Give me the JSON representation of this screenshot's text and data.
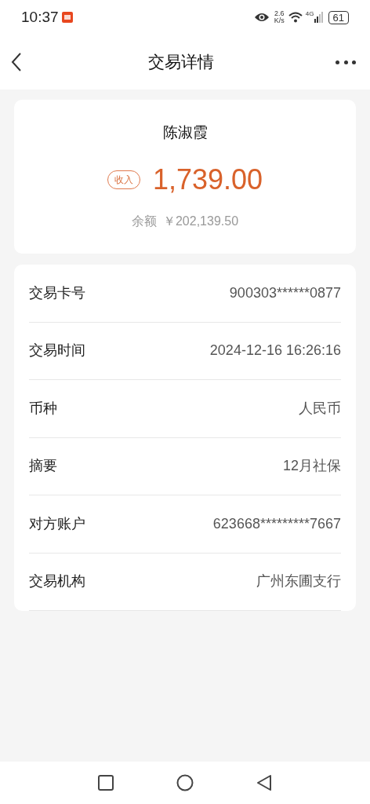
{
  "status_bar": {
    "time": "10:37",
    "net_speed": "2.6",
    "net_unit": "K/s",
    "network": "4G",
    "battery": "61"
  },
  "header": {
    "title": "交易详情"
  },
  "summary": {
    "name": "陈淑霞",
    "tag": "收入",
    "amount": "1,739.00",
    "balance_label": "余额",
    "balance": "￥202,139.50"
  },
  "details": [
    {
      "label": "交易卡号",
      "value": "900303******0877"
    },
    {
      "label": "交易时间",
      "value": "2024-12-16 16:26:16"
    },
    {
      "label": "币种",
      "value": "人民币"
    },
    {
      "label": "摘要",
      "value": "12月社保"
    },
    {
      "label": "对方账户",
      "value": "623668*********7667"
    },
    {
      "label": "交易机构",
      "value": "广州东圃支行"
    }
  ]
}
